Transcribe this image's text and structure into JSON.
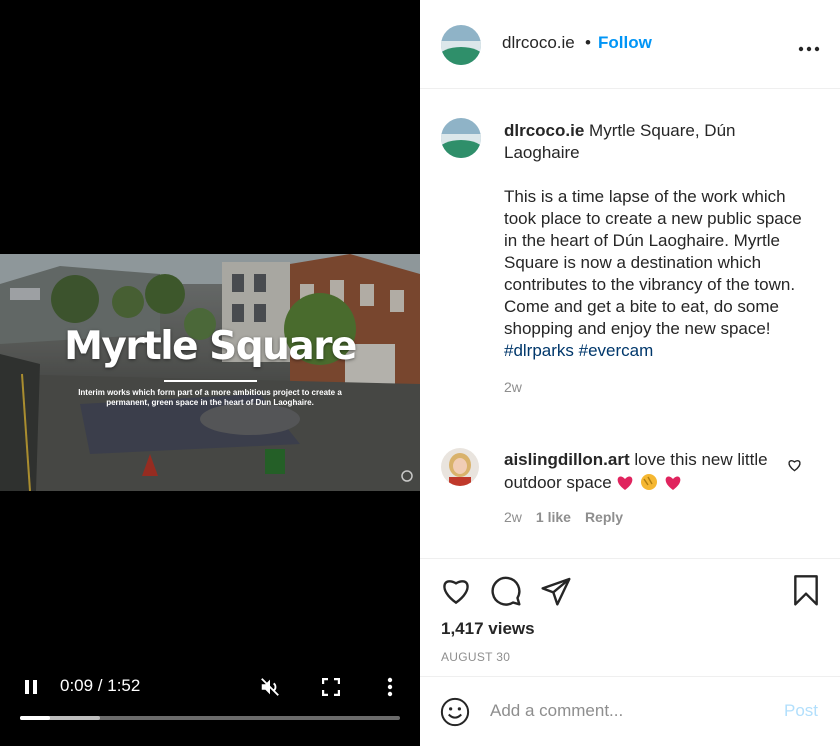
{
  "video": {
    "overlay_title": "Myrtle Square",
    "overlay_subtitle": "Interim works which form part of a more ambitious project to create a permanent, green space in the heart of Dun Laoghaire.",
    "time": "0:09 / 1:52",
    "played_fraction": 0.08,
    "buffered_fraction": 0.21,
    "controls": [
      "pause-icon",
      "mute-icon",
      "fullscreen-icon",
      "more-vertical-icon"
    ]
  },
  "header": {
    "username": "dlrcoco.ie",
    "separator": "•",
    "follow_label": "Follow"
  },
  "caption": {
    "username": "dlrcoco.ie",
    "location": "Myrtle Square, Dún Laoghaire",
    "body": "This is a time lapse of the work which took place to create a new public space in the heart of Dún Laoghaire. Myrtle Square is now a destination which contributes to the vibrancy of the town.\nCome and get a bite to eat, do some shopping and enjoy the new space!",
    "hashtags": "#dlrparks #evercam",
    "age": "2w"
  },
  "comment": {
    "username": "aislingdillon.art",
    "text": "love this new little outdoor space",
    "age": "2w",
    "likes": "1 like",
    "reply_label": "Reply"
  },
  "stats": {
    "views": "1,417 views",
    "date": "AUGUST 30"
  },
  "add_comment": {
    "placeholder": "Add a comment...",
    "post_label": "Post"
  },
  "colors": {
    "link": "#0095f6",
    "post_disabled": "#b2dffc",
    "muted": "#8e8e8e",
    "heart_emoji": "#e0245e"
  }
}
